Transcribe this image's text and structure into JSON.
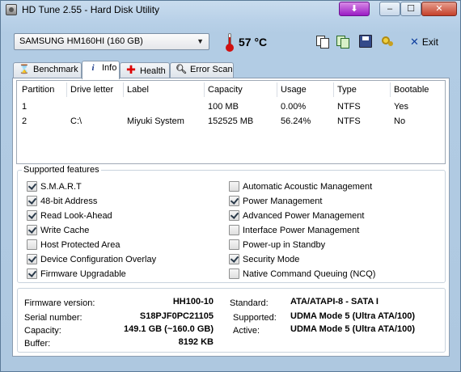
{
  "window": {
    "title": "HD Tune 2.55 - Hard Disk Utility"
  },
  "toolbar": {
    "drive": "SAMSUNG HM160HI (160 GB)",
    "temperature": "57 °C",
    "exit_label": "Exit",
    "icons": [
      "thermometer-icon",
      "copy-icon",
      "copy-all-icon",
      "save-icon",
      "options-icon",
      "exit-icon"
    ]
  },
  "tabs": [
    {
      "label": "Benchmark",
      "icon": "benchmark-icon"
    },
    {
      "label": "Info",
      "icon": "info-icon",
      "active": true
    },
    {
      "label": "Health",
      "icon": "health-icon"
    },
    {
      "label": "Error Scan",
      "icon": "error-scan-icon"
    }
  ],
  "partitions": {
    "headers": [
      "Partition",
      "Drive letter",
      "Label",
      "Capacity",
      "Usage",
      "Type",
      "Bootable"
    ],
    "rows": [
      [
        "1",
        "",
        "",
        "100 MB",
        "0.00%",
        "NTFS",
        "Yes"
      ],
      [
        "2",
        "C:\\",
        "Miyuki System",
        "152525 MB",
        "56.24%",
        "NTFS",
        "No"
      ]
    ]
  },
  "features": {
    "title": "Supported features",
    "left": [
      {
        "label": "S.M.A.R.T",
        "checked": true
      },
      {
        "label": "48-bit Address",
        "checked": true
      },
      {
        "label": "Read Look-Ahead",
        "checked": true
      },
      {
        "label": "Write Cache",
        "checked": true
      },
      {
        "label": "Host Protected Area",
        "checked": false
      },
      {
        "label": "Device Configuration Overlay",
        "checked": true
      },
      {
        "label": "Firmware Upgradable",
        "checked": true
      }
    ],
    "right": [
      {
        "label": "Automatic Acoustic Management",
        "checked": false
      },
      {
        "label": "Power Management",
        "checked": true
      },
      {
        "label": "Advanced Power Management",
        "checked": true
      },
      {
        "label": "Interface Power Management",
        "checked": false
      },
      {
        "label": "Power-up in Standby",
        "checked": false
      },
      {
        "label": "Security Mode",
        "checked": true
      },
      {
        "label": "Native Command Queuing (NCQ)",
        "checked": false
      }
    ]
  },
  "info": {
    "firmware_label": "Firmware version:",
    "firmware": "HH100-10",
    "serial_label": "Serial number:",
    "serial": "S18PJF0PC21105",
    "capacity_label": "Capacity:",
    "capacity": "149.1 GB (~160.0 GB)",
    "buffer_label": "Buffer:",
    "buffer": "8192 KB",
    "standard_label": "Standard:",
    "standard": "ATA/ATAPI-8 - SATA I",
    "supported_label": "Supported:",
    "supported": "UDMA Mode 5 (Ultra ATA/100)",
    "active_label": "Active:",
    "active": "UDMA Mode 5 (Ultra ATA/100)"
  }
}
